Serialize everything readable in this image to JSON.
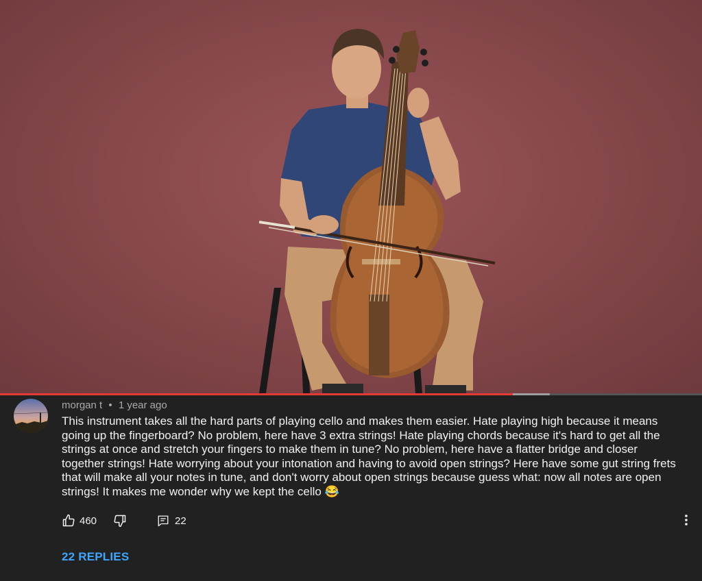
{
  "video": {
    "progress_played": 0.73,
    "progress_buffered": 0.783
  },
  "comment": {
    "author": "morgan t",
    "separator": "•",
    "timestamp": "1 year ago",
    "text": "This instrument takes all the hard parts of playing cello and makes them easier. Hate playing high because it means going up the fingerboard? No problem, here have 3 extra strings! Hate playing chords because it's hard to get all the strings at once and stretch your fingers to make them in tune? No problem, here have a flatter bridge and closer together strings! Hate worrying about your intonation and having to avoid open strings? Here have some gut string frets that will make all your notes in tune, and don't worry about open strings because guess what: now all notes are open strings! It makes me wonder why we kept the cello 😂",
    "like_count": "460",
    "reply_count": "22",
    "replies_label": "22 REPLIES"
  },
  "icons": {
    "like": "thumbs-up-icon",
    "dislike": "thumbs-down-icon",
    "reply": "comment-icon",
    "more": "more-vertical-icon"
  },
  "colors": {
    "background": "#212121",
    "progress_played": "#e53935",
    "replies_link": "#3ea6ff",
    "meta_text": "#aaaaaa"
  }
}
